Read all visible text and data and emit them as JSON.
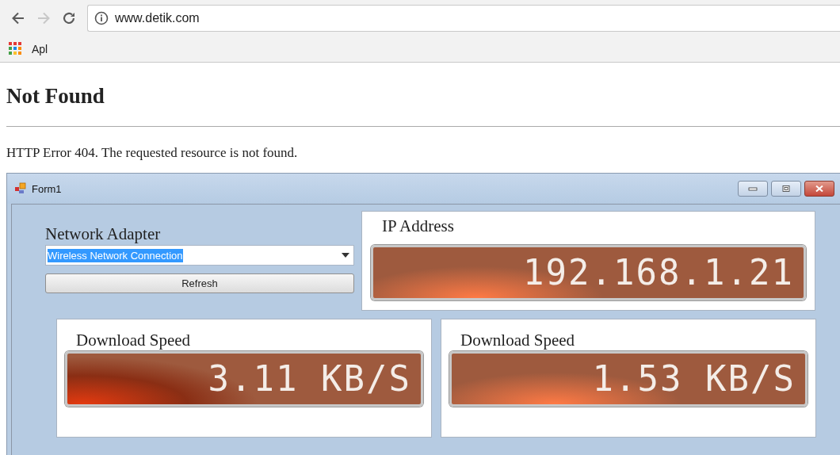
{
  "browser": {
    "nav_buttons": [
      {
        "kind": "back",
        "disabled": false
      },
      {
        "kind": "forward",
        "disabled": true
      },
      {
        "kind": "reload",
        "disabled": false
      }
    ],
    "url": "www.detik.com",
    "bookmarks": [
      {
        "label": "Apl"
      }
    ]
  },
  "page": {
    "heading": "Not Found",
    "message": "HTTP Error 404. The requested resource is not found."
  },
  "form": {
    "title": "Form1",
    "adapter": {
      "label": "Network Adapter",
      "value": "Wireless Network Connection",
      "text_selected": true
    },
    "refresh_button": "Refresh",
    "ip": {
      "label": "IP Address",
      "reading": "192.168.1.21"
    },
    "speeds": [
      {
        "label": "Download Speed",
        "reading": "3.11 KB/S"
      },
      {
        "label": "Download Speed",
        "reading": "1.53 KB/S"
      }
    ]
  }
}
